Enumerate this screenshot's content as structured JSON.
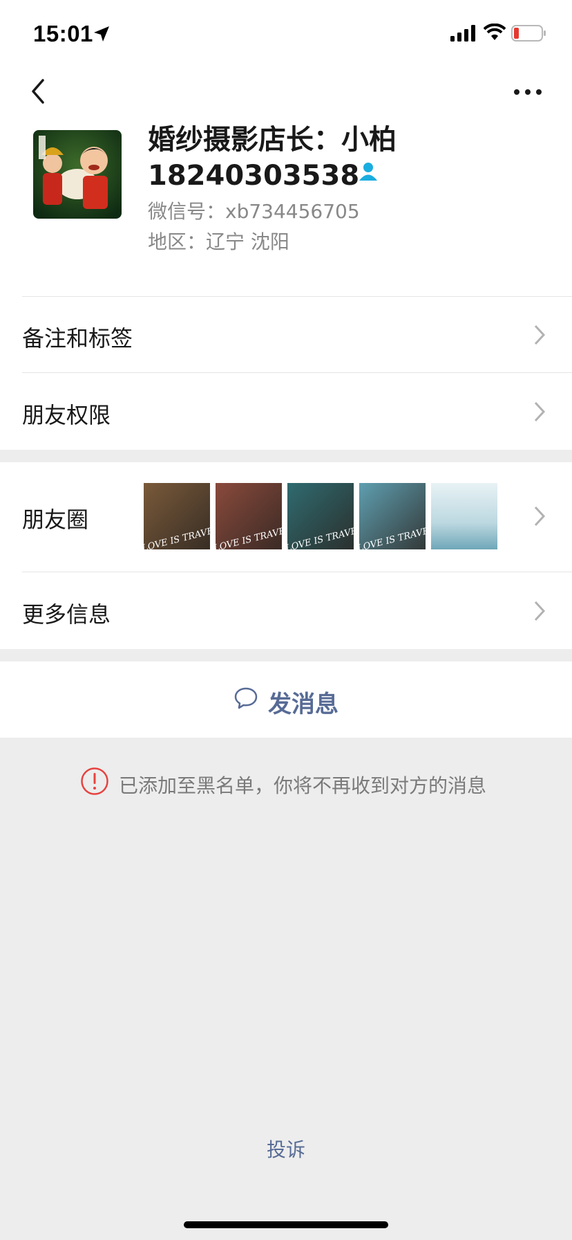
{
  "status_bar": {
    "time": "15:01"
  },
  "profile": {
    "name": "婚纱摄影店长：小柏",
    "phone": "18240303538",
    "wechat_id": "微信号：xb734456705",
    "region": "地区：辽宁 沈阳"
  },
  "cells": {
    "remarks_tags": "备注和标签",
    "friend_permissions": "朋友权限",
    "moments": "朋友圈",
    "more_info": "更多信息"
  },
  "moments_photos": [
    {
      "caption": "LOVE IS TRAVELING",
      "color": "#7a5a3a"
    },
    {
      "caption": "LOVE IS TRAVELING",
      "color": "#8a4a3c"
    },
    {
      "caption": "LOVE IS TRAVELING",
      "color": "#2f6b70"
    },
    {
      "caption": "LOVE IS TRAVELING",
      "color": "#5f9fb0"
    },
    {
      "caption": "",
      "color": "#bcd8e0"
    }
  ],
  "actions": {
    "send_message": "发消息",
    "complain": "投诉"
  },
  "notice": "已添加至黑名单，你将不再收到对方的消息",
  "colors": {
    "link_blue": "#576b95",
    "alert_red": "#e64340",
    "contact_icon_blue": "#1aade0"
  }
}
